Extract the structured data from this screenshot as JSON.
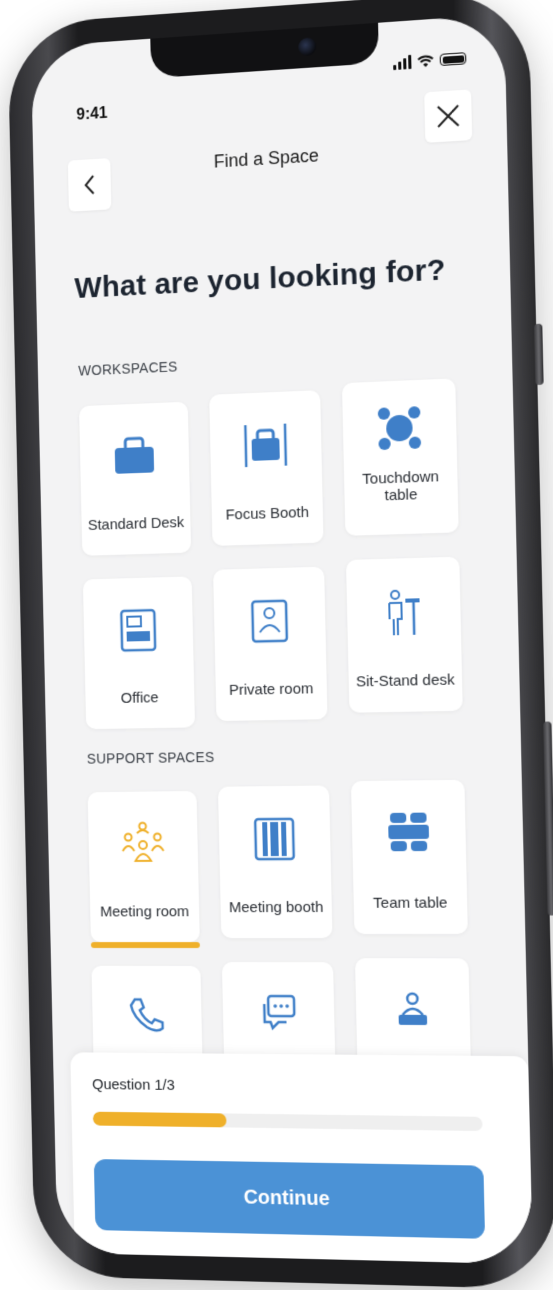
{
  "status_bar": {
    "time": "9:41"
  },
  "nav": {
    "title": "Find a Space",
    "back_icon": "chevron-left-icon",
    "close_icon": "close-icon"
  },
  "headline": "What are you looking for?",
  "sections": {
    "workspaces": {
      "label": "WORKSPACES",
      "items": [
        {
          "label": "Standard Desk",
          "icon": "desk-icon"
        },
        {
          "label": "Focus Booth",
          "icon": "booth-icon"
        },
        {
          "label": "Touchdown table",
          "icon": "touchdown-table-icon"
        },
        {
          "label": "Office",
          "icon": "office-icon"
        },
        {
          "label": "Private room",
          "icon": "private-room-icon"
        },
        {
          "label": "Sit-Stand desk",
          "icon": "sit-stand-desk-icon"
        }
      ]
    },
    "support_spaces": {
      "label": "SUPPORT SPACES",
      "items": [
        {
          "label": "Meeting room",
          "icon": "meeting-room-icon",
          "selected": true
        },
        {
          "label": "Meeting booth",
          "icon": "meeting-booth-icon"
        },
        {
          "label": "Team table",
          "icon": "team-table-icon"
        },
        {
          "label": "",
          "icon": "phone-icon"
        },
        {
          "label": "",
          "icon": "chat-icon"
        },
        {
          "label": "",
          "icon": "reception-icon"
        }
      ]
    }
  },
  "footer": {
    "question": "Question 1/3",
    "progress": 0.35,
    "continue_label": "Continue"
  },
  "colors": {
    "accent": "#efb02a",
    "primary": "#4b92d6",
    "icon_blue": "#3f7fc8"
  }
}
